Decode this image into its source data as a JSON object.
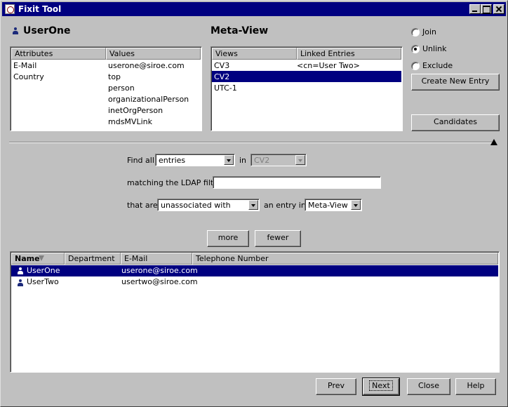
{
  "window": {
    "title": "Fixit Tool"
  },
  "entry": {
    "name": "UserOne"
  },
  "attributes_table": {
    "columns": [
      "Attributes",
      "Values"
    ],
    "rows": [
      {
        "attribute": "E-Mail",
        "value": "userone@siroe.com"
      },
      {
        "attribute": "Country",
        "value": "top"
      },
      {
        "attribute": "",
        "value": "person"
      },
      {
        "attribute": "",
        "value": "organizationalPerson"
      },
      {
        "attribute": "",
        "value": "inetOrgPerson"
      },
      {
        "attribute": "",
        "value": "mdsMVLink"
      }
    ]
  },
  "meta_view": {
    "title": "Meta-View",
    "columns": [
      "Views",
      "Linked Entries"
    ],
    "rows": [
      {
        "view": "CV3",
        "linked": "<cn=User Two>"
      },
      {
        "view": "CV2",
        "linked": ""
      },
      {
        "view": "UTC-1",
        "linked": ""
      }
    ],
    "selected_index": 1
  },
  "actions": {
    "radios": [
      {
        "label": "Join",
        "checked": false
      },
      {
        "label": "Unlink",
        "checked": true
      },
      {
        "label": "Exclude",
        "checked": false
      }
    ],
    "create_new_entry": "Create New Entry",
    "candidates": "Candidates"
  },
  "search": {
    "find_all_label": "Find all",
    "find_all_value": "entries",
    "in_label": "in",
    "in_value": "CV2",
    "ldap_filter_label": "matching the LDAP filter",
    "ldap_filter_value": "",
    "that_are_label": "that are",
    "association_value": "unassociated with",
    "entry_in_label": "an entry in",
    "entry_in_value": "Meta-View",
    "more": "more",
    "fewer": "fewer"
  },
  "results_table": {
    "columns": [
      "Name",
      "Department",
      "E-Mail",
      "Telephone Number"
    ],
    "rows": [
      {
        "name": "UserOne",
        "department": "",
        "email": "userone@siroe.com",
        "phone": ""
      },
      {
        "name": "UserTwo",
        "department": "",
        "email": "usertwo@siroe.com",
        "phone": ""
      }
    ],
    "selected_index": 0
  },
  "footer": {
    "prev": "Prev",
    "next": "Next",
    "close": "Close",
    "help": "Help"
  },
  "colors": {
    "selection": "#000080",
    "face": "#c0c0c0",
    "titlebar": "#000080"
  }
}
